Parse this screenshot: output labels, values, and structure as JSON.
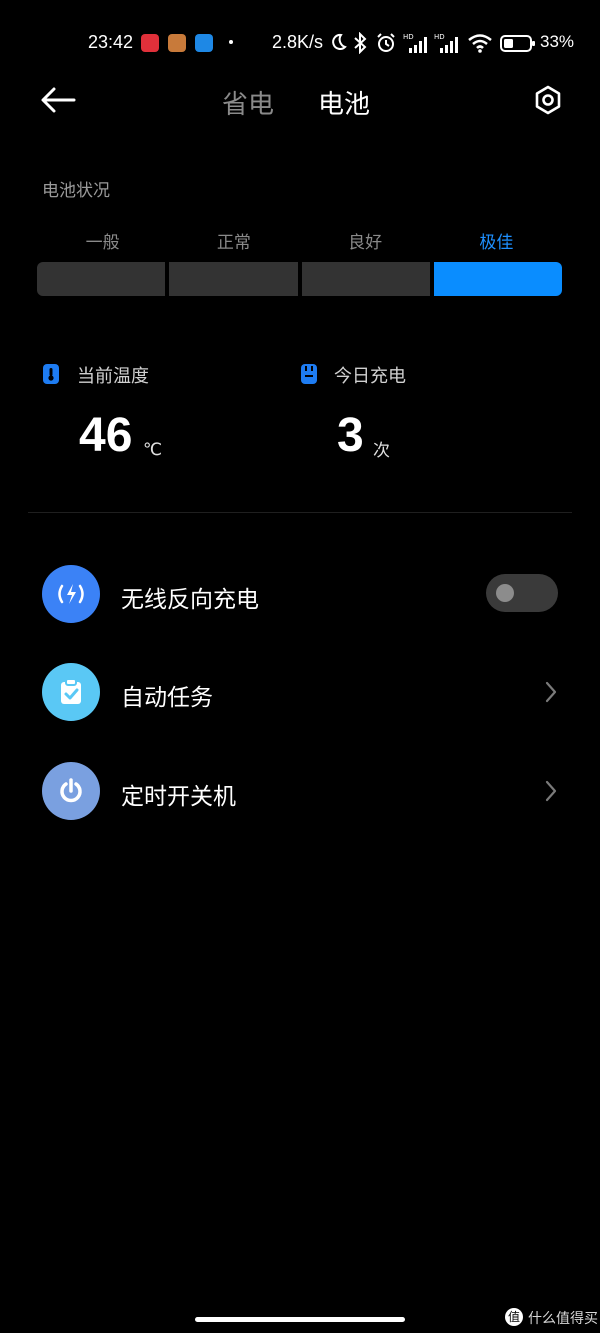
{
  "status_bar": {
    "time": "23:42",
    "network_speed": "2.8K/s",
    "battery_percent": "33%",
    "icons": [
      "app-icon-1",
      "app-icon-2",
      "app-icon-3",
      "moon-icon",
      "bluetooth-icon",
      "alarm-icon",
      "signal-hd-icon",
      "signal-hd-icon",
      "wifi-icon",
      "battery-icon"
    ]
  },
  "header": {
    "tab_power_saving": "省电",
    "tab_battery": "电池"
  },
  "battery_health": {
    "label": "电池状况",
    "levels": [
      "一般",
      "正常",
      "良好",
      "极佳"
    ],
    "current_index": 3
  },
  "stats": {
    "temperature_label": "当前温度",
    "temperature_value": "46",
    "temperature_unit": "℃",
    "charges_label": "今日充电",
    "charges_value": "3",
    "charges_unit": "次"
  },
  "rows": {
    "wireless_reverse_charging": {
      "label": "无线反向充电",
      "enabled": false
    },
    "auto_tasks": {
      "label": "自动任务"
    },
    "scheduled_power": {
      "label": "定时开关机"
    }
  },
  "watermark": {
    "badge": "值",
    "text": "什么值得买"
  },
  "colors": {
    "accent": "#0a8dff",
    "segment_off": "#333333",
    "icon_wireless": "#3b82f6",
    "icon_tasks": "#5ac8f5",
    "icon_power": "#7aa0e0"
  }
}
